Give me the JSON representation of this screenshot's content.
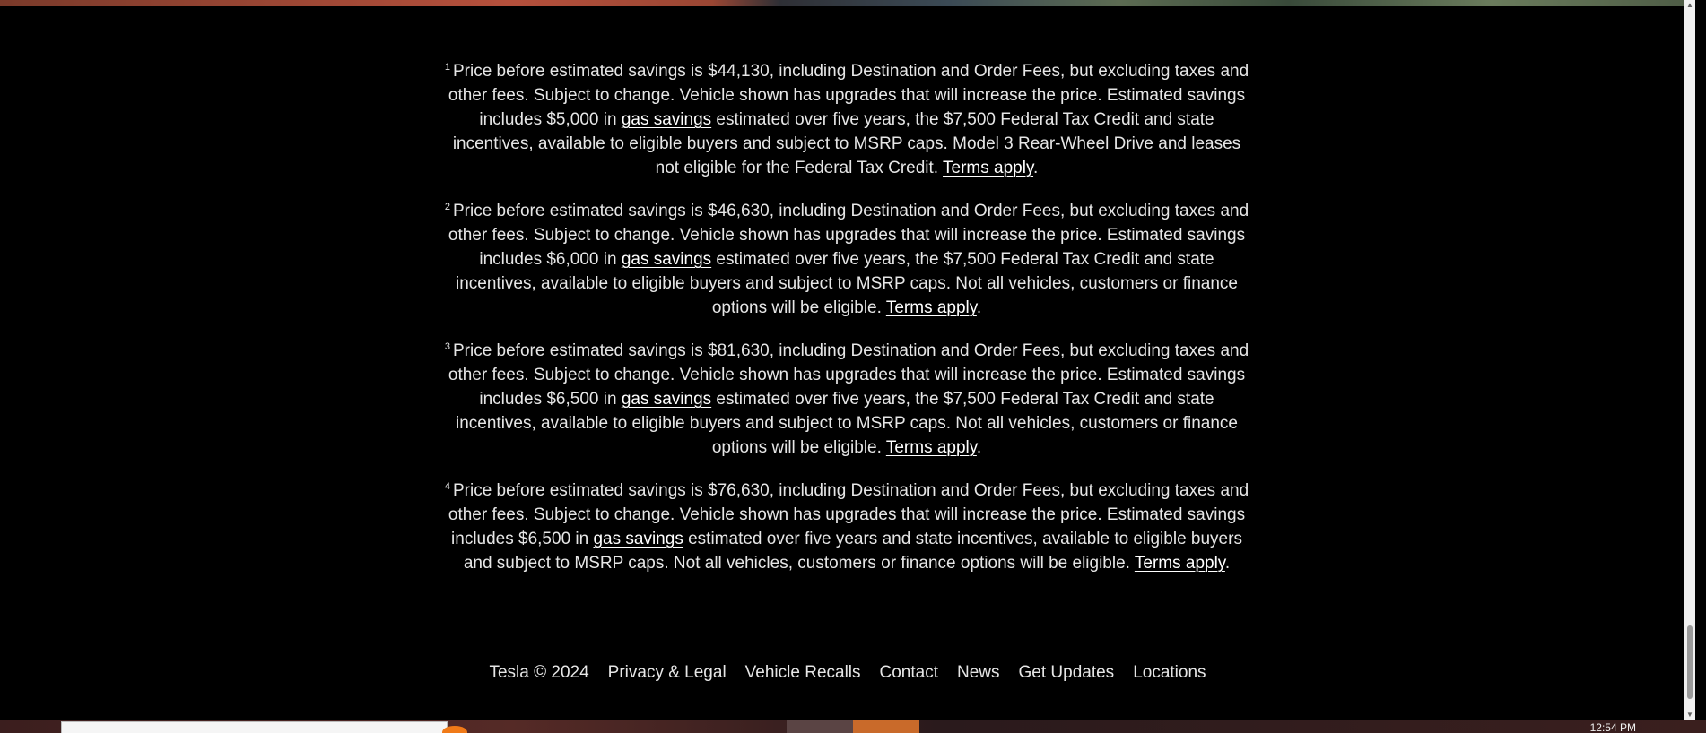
{
  "disclaimers": [
    {
      "num": "1",
      "before": "Price before estimated savings is $44,130, including Destination and Order Fees, but excluding taxes and other fees. Subject to change. Vehicle shown has upgrades that will increase the price. Estimated savings includes $5,000 in ",
      "link1": "gas savings",
      "middle": " estimated over five years, the $7,500 Federal Tax Credit and state incentives, available to eligible buyers and subject to MSRP caps. Model 3 Rear-Wheel Drive and leases not eligible for the Federal Tax Credit. ",
      "link2": "Terms apply",
      "after": "."
    },
    {
      "num": "2",
      "before": "Price before estimated savings is $46,630, including Destination and Order Fees, but excluding taxes and other fees. Subject to change. Vehicle shown has upgrades that will increase the price. Estimated savings includes $6,000 in ",
      "link1": "gas savings",
      "middle": " estimated over five years, the $7,500 Federal Tax Credit and state incentives, available to eligible buyers and subject to MSRP caps. Not all vehicles, customers or finance options will be eligible. ",
      "link2": "Terms apply",
      "after": "."
    },
    {
      "num": "3",
      "before": "Price before estimated savings is $81,630, including Destination and Order Fees, but excluding taxes and other fees. Subject to change. Vehicle shown has upgrades that will increase the price. Estimated savings includes $6,500 in ",
      "link1": "gas savings",
      "middle": " estimated over five years, the $7,500 Federal Tax Credit and state incentives, available to eligible buyers and subject to MSRP caps. Not all vehicles, customers or finance options will be eligible. ",
      "link2": "Terms apply",
      "after": "."
    },
    {
      "num": "4",
      "before": "Price before estimated savings is $76,630, including Destination and Order Fees, but excluding taxes and other fees. Subject to change. Vehicle shown has upgrades that will increase the price. Estimated savings includes $6,500 in ",
      "link1": "gas savings",
      "middle": " estimated over five years and state incentives, available to eligible buyers and subject to MSRP caps. Not all vehicles, customers or finance options will be eligible. ",
      "link2": "Terms apply",
      "after": "."
    }
  ],
  "footer": {
    "copyright": "Tesla © 2024",
    "links": [
      "Privacy & Legal",
      "Vehicle Recalls",
      "Contact",
      "News",
      "Get Updates",
      "Locations"
    ]
  },
  "scrollbar": {
    "up_icon": "scroll-up-arrow-icon",
    "down_icon": "scroll-down-arrow-icon"
  },
  "taskbar": {
    "clock": "12:54 PM"
  },
  "colors": {
    "background": "#000000",
    "text": "#e6e6e6",
    "link": "#ffffff"
  }
}
